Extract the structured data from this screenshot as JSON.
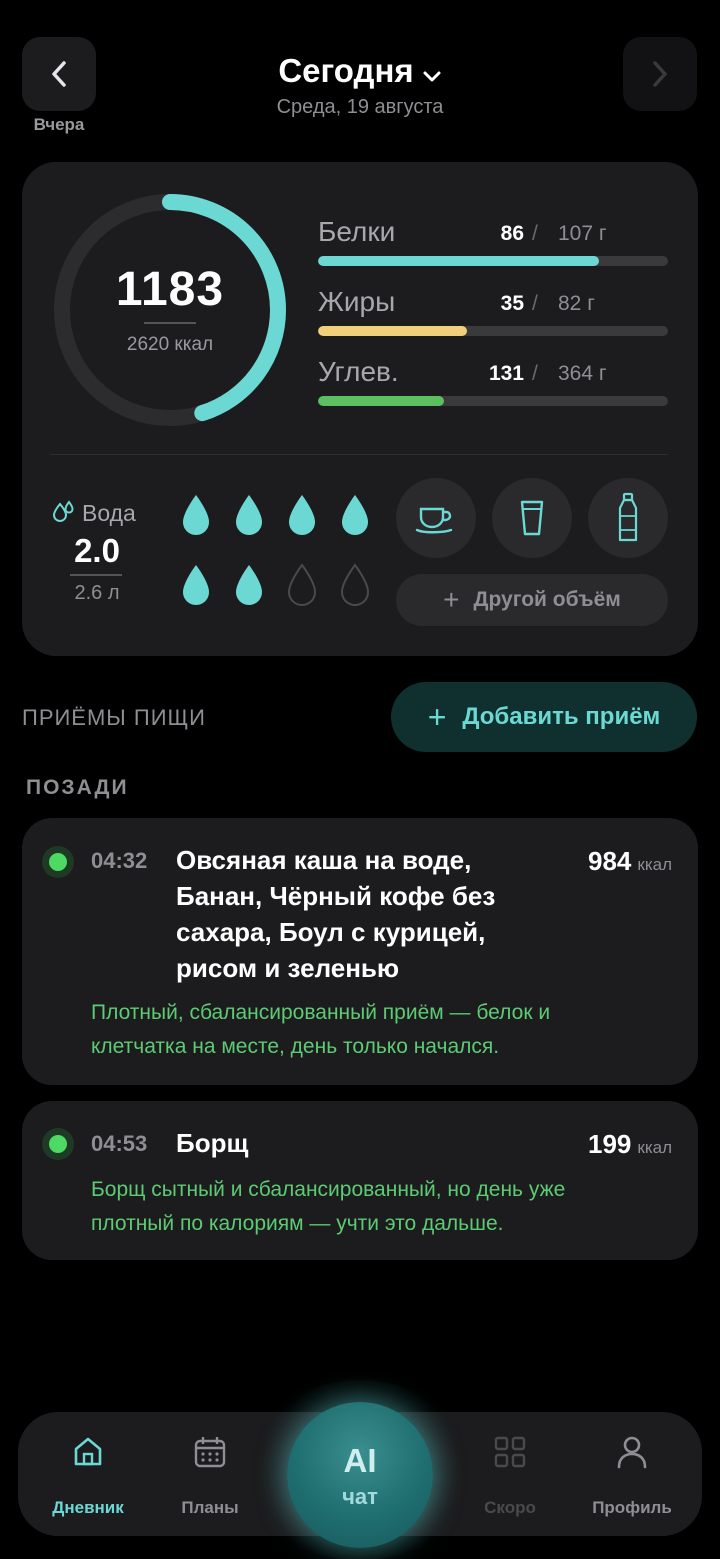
{
  "header": {
    "title": "Сегодня",
    "subtitle": "Среда, 19 августа",
    "prev_label": "Вчера",
    "prev_icon": "chevron-left-icon",
    "next_icon": "chevron-right-icon",
    "dropdown_icon": "chevron-down-icon"
  },
  "calories": {
    "value": "1183",
    "goal": "2620 ккал",
    "progress": 0.4515
  },
  "macros": [
    {
      "name": "Белки",
      "value": "86",
      "sep": "/",
      "goal": "107 г",
      "progress": 0.804,
      "color": "#6bd8d4"
    },
    {
      "name": "Жиры",
      "value": "35",
      "sep": "/",
      "goal": "82 г",
      "progress": 0.427,
      "color": "#f0d07a"
    },
    {
      "name": "Углев.",
      "value": "131",
      "sep": "/",
      "goal": "364 г",
      "progress": 0.36,
      "color": "#5cc061"
    }
  ],
  "water": {
    "label": "Вода",
    "value": "2.0",
    "goal": "2.6 л",
    "drops_filled": 6,
    "drops_total": 8,
    "vessels": [
      "cup-icon",
      "glass-icon",
      "bottle-icon"
    ],
    "other_volume": "Другой объём"
  },
  "meals_section": {
    "title": "ПРИЁМЫ ПИЩИ",
    "add_label": "Добавить приём",
    "subsection": "ПОЗАДИ"
  },
  "meals": [
    {
      "time": "04:32",
      "name_lines": [
        "Овсяная каша на воде,",
        "Банан, Чёрный кофе без",
        "сахара, Боул с курицей,",
        "рисом и зеленью"
      ],
      "kcal": "984",
      "unit": "ккал",
      "note_lines": [
        "Плотный, сбалансированный приём — белок и",
        "клетчатка на месте, день только начался."
      ]
    },
    {
      "time": "04:53",
      "name_lines": [
        "Борщ"
      ],
      "kcal": "199",
      "unit": "ккал",
      "note_lines": [
        "Борщ сытный и сбалансированный, но день уже",
        "плотный по калориям — учти это дальше."
      ]
    }
  ],
  "tabbar": {
    "diary": "Дневник",
    "plans": "Планы",
    "ai_title": "AI",
    "ai_sub": "чат",
    "soon": "Скоро",
    "profile": "Профиль"
  },
  "colors": {
    "accent": "#6bd8d4",
    "note_green": "#5ccb73",
    "card": "#1c1c1e"
  }
}
